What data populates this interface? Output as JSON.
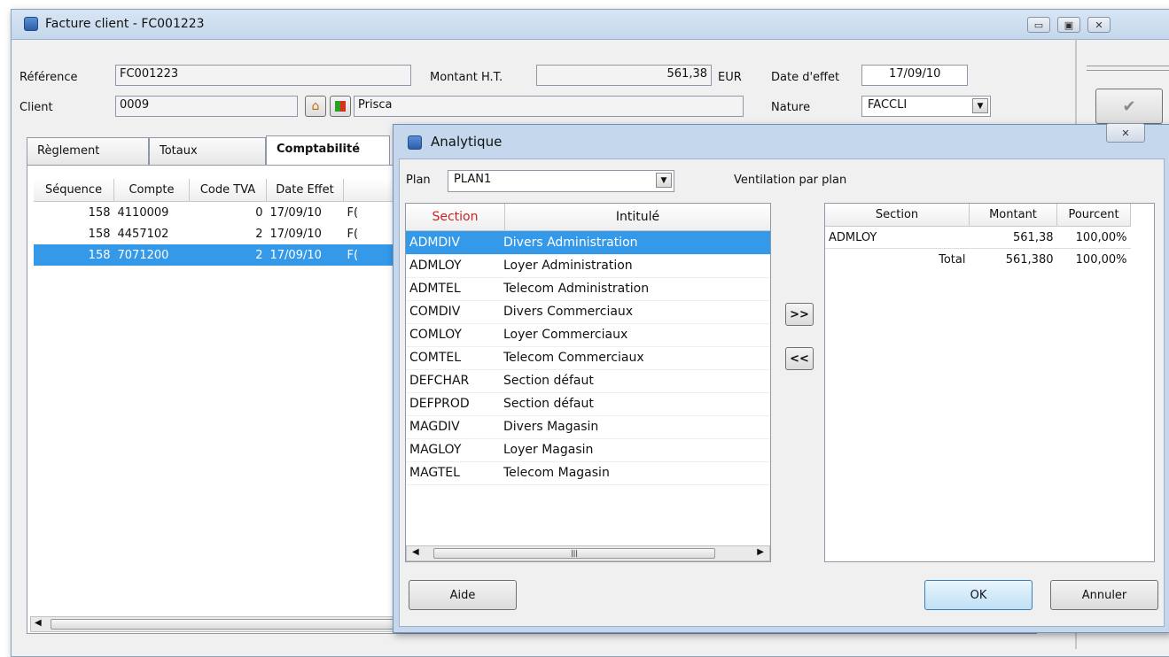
{
  "window": {
    "title": "Facture client - FC001223",
    "minimize_icon": "minimize-icon",
    "maximize_icon": "maximize-icon",
    "close_icon": "close-icon"
  },
  "header": {
    "reference_label": "Référence",
    "reference_value": "FC001223",
    "montant_label": "Montant H.T.",
    "montant_value": "561,38",
    "currency": "EUR",
    "date_effet_label": "Date d'effet",
    "date_effet_value": "17/09/10",
    "client_label": "Client",
    "client_value": "0009",
    "client_name": "Prisca",
    "nature_label": "Nature",
    "nature_value": "FACCLI"
  },
  "tabs": [
    "Règlement",
    "Totaux",
    "Comptabilité"
  ],
  "accounting_grid": {
    "headers": [
      "Séquence",
      "Compte",
      "Code TVA",
      "Date Effet"
    ],
    "rows": [
      {
        "sequence": "158",
        "compte": "4110009",
        "code_tva": "0",
        "date": "17/09/10",
        "extra": "F("
      },
      {
        "sequence": "158",
        "compte": "4457102",
        "code_tva": "2",
        "date": "17/09/10",
        "extra": "F("
      },
      {
        "sequence": "158",
        "compte": "7071200",
        "code_tva": "2",
        "date": "17/09/10",
        "extra": "F("
      }
    ]
  },
  "dialog": {
    "title": "Analytique",
    "plan_label": "Plan",
    "plan_value": "PLAN1",
    "ventilation_label": "Ventilation par plan",
    "section_col": "Section",
    "intitule_col": "Intitulé",
    "sections": [
      {
        "code": "ADMDIV",
        "label": "Divers Administration"
      },
      {
        "code": "ADMLOY",
        "label": "Loyer Administration"
      },
      {
        "code": "ADMTEL",
        "label": "Telecom Administration"
      },
      {
        "code": "COMDIV",
        "label": "Divers Commerciaux"
      },
      {
        "code": "COMLOY",
        "label": "Loyer Commerciaux"
      },
      {
        "code": "COMTEL",
        "label": "Telecom Commerciaux"
      },
      {
        "code": "DEFCHAR",
        "label": "Section défaut"
      },
      {
        "code": "DEFPROD",
        "label": "Section défaut"
      },
      {
        "code": "MAGDIV",
        "label": "Divers Magasin"
      },
      {
        "code": "MAGLOY",
        "label": "Loyer Magasin"
      },
      {
        "code": "MAGTEL",
        "label": "Telecom Magasin"
      }
    ],
    "add_button": ">>",
    "remove_button": "<<",
    "ventilation": {
      "headers": [
        "Section",
        "Montant",
        "Pourcent"
      ],
      "rows": [
        {
          "section": "ADMLOY",
          "montant": "561,38",
          "pourcent": "100,00%"
        }
      ],
      "total_label": "Total",
      "total_montant": "561,380",
      "total_pourcent": "100,00%"
    },
    "aide_button": "Aide",
    "ok_button": "OK",
    "annuler_button": "Annuler"
  },
  "colors": {
    "selection": "#3399e8",
    "section_header_red": "#cc2222",
    "dialog_frame": "#c4d7ec"
  }
}
